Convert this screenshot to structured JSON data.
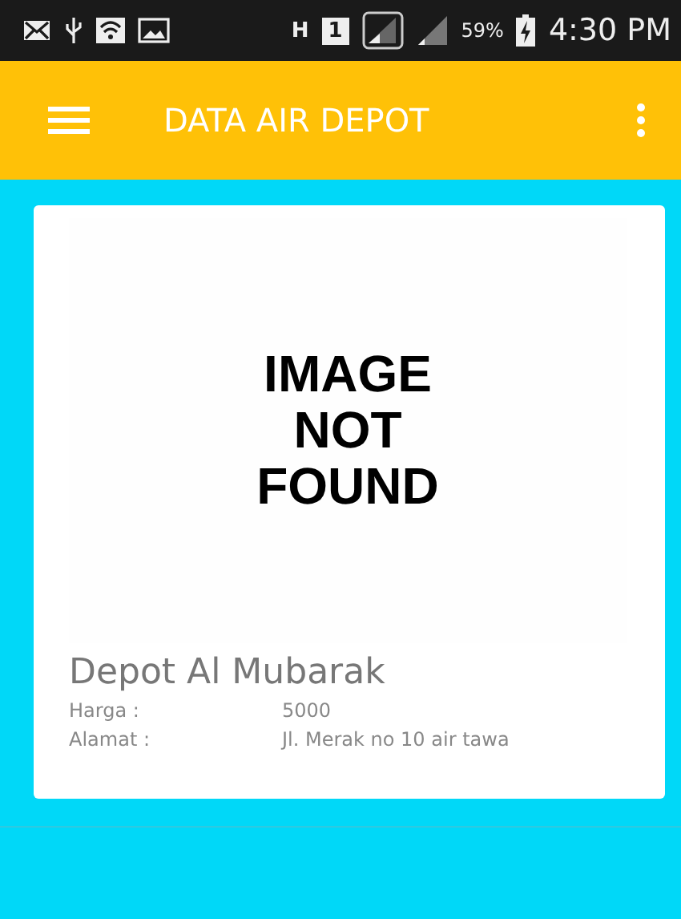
{
  "status_bar": {
    "network": "H",
    "sim": "1",
    "battery": "59%",
    "time": "4:30 PM"
  },
  "toolbar": {
    "title": "DATA AIR DEPOT"
  },
  "cards": [
    {
      "image_text": [
        "IMAGE",
        "NOT",
        "FOUND"
      ],
      "name": "Depot  Al Mubarak",
      "fields": [
        {
          "label": "Harga :",
          "value": "5000"
        },
        {
          "label": "Alamat :",
          "value": "Jl. Merak no 10 air tawa"
        }
      ]
    }
  ]
}
